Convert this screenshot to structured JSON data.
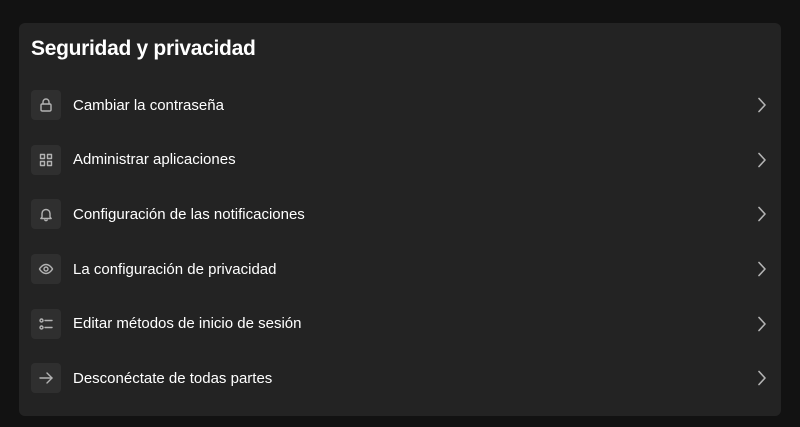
{
  "section": {
    "title": "Seguridad y privacidad"
  },
  "items": [
    {
      "label": "Cambiar la contraseña",
      "icon": "lock-icon"
    },
    {
      "label": "Administrar aplicaciones",
      "icon": "apps-grid-icon"
    },
    {
      "label": "Configuración de las notificaciones",
      "icon": "bell-icon"
    },
    {
      "label": "La configuración de privacidad",
      "icon": "eye-icon"
    },
    {
      "label": "Editar métodos de inicio de sesión",
      "icon": "login-methods-icon"
    },
    {
      "label": "Desconéctate de todas partes",
      "icon": "arrow-right-icon"
    }
  ],
  "colors": {
    "page_background": "#121212",
    "card_background": "#232323",
    "icon_tile": "#2f2f2f",
    "text": "#ffffff",
    "icon": "#b3b3b3"
  }
}
